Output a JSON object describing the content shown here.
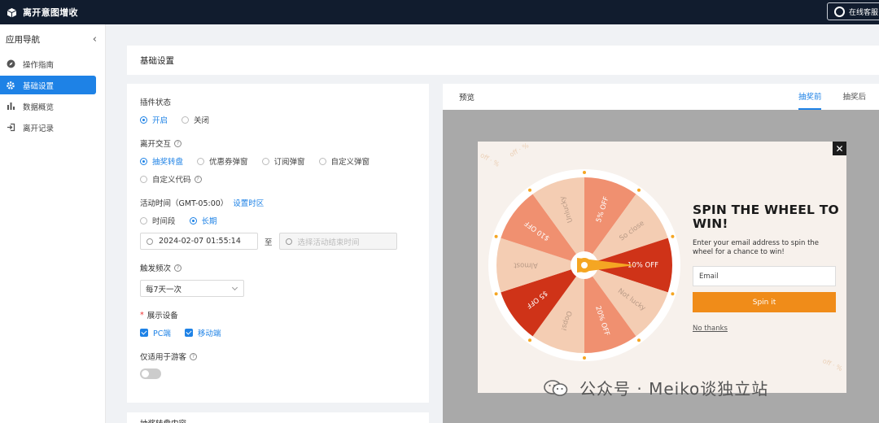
{
  "app": {
    "title": "离开意图增收",
    "support_label": "在线客服"
  },
  "sidebar": {
    "heading": "应用导航",
    "items": [
      {
        "label": "操作指南",
        "icon": "compass-icon"
      },
      {
        "label": "基础设置",
        "icon": "gear-icon",
        "active": true
      },
      {
        "label": "数据概览",
        "icon": "bar-chart-icon"
      },
      {
        "label": "离开记录",
        "icon": "exit-icon"
      }
    ]
  },
  "page": {
    "title": "基础设置"
  },
  "settings": {
    "plugin_status": {
      "label": "插件状态",
      "options": [
        "开启",
        "关闭"
      ],
      "selected": "开启"
    },
    "exit_interaction": {
      "label": "离开交互",
      "options": [
        "抽奖转盘",
        "优惠券弹窗",
        "订阅弹窗",
        "自定义弹窗",
        "自定义代码"
      ],
      "selected": "抽奖转盘"
    },
    "activity_time": {
      "label": "活动时间（GMT-05:00）",
      "link": "设置时区",
      "options": [
        "时间段",
        "长期"
      ],
      "selected": "长期",
      "start_value": "2024-02-07 01:55:14",
      "separator": "至",
      "end_placeholder": "选择活动结束时间"
    },
    "trigger_frequency": {
      "label": "触发频次",
      "value": "每7天一次"
    },
    "display_devices": {
      "label": "展示设备",
      "options": [
        "PC端",
        "移动端"
      ],
      "checked": [
        "PC端",
        "移动端"
      ]
    },
    "guest_only": {
      "label": "仅适用于游客",
      "enabled": false
    },
    "next_section_title": "抽奖转盘内容"
  },
  "preview": {
    "label": "预览",
    "tabs": [
      "抽奖前",
      "抽奖后"
    ],
    "active_tab": "抽奖前",
    "popup": {
      "headline": "SPIN THE WHEEL TO WIN!",
      "subtext": "Enter your email address to spin the wheel for a chance to win!",
      "email_placeholder": "Email",
      "spin_button": "Spin it",
      "no_thanks": "No thanks",
      "close_icon": "close-icon",
      "wheel_segments": [
        "5% OFF",
        "So close",
        "10% OFF",
        "Not lucky",
        "20% OFF",
        "Oops!",
        "$5 OFF",
        "Almost",
        "$10 OFF",
        "Unlucky"
      ],
      "colors": {
        "dark": "#cf3318",
        "mid": "#f09070",
        "light": "#f4cdb3",
        "pointer": "#f5a623"
      }
    }
  },
  "watermark": "公众号 · Meiko谈独立站"
}
